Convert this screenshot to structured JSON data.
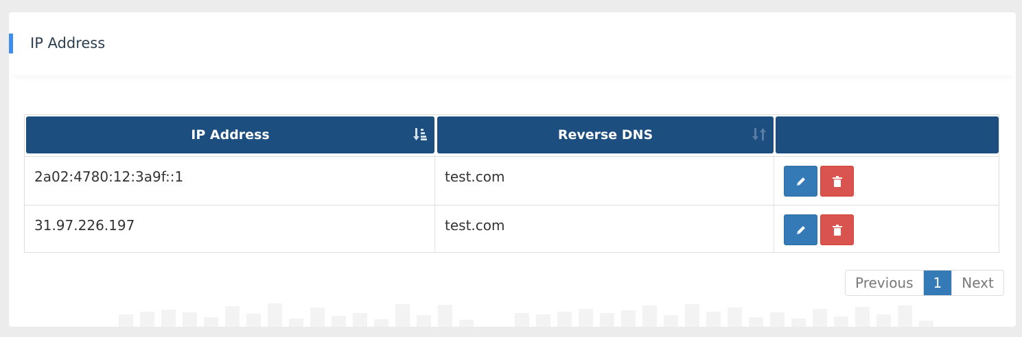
{
  "panel": {
    "title": "IP Address"
  },
  "table": {
    "columns": [
      {
        "label": "IP Address",
        "sort": "sorted-asc"
      },
      {
        "label": "Reverse DNS",
        "sort": "sortable"
      },
      {
        "label": ""
      }
    ],
    "rows": [
      {
        "ip": "2a02:4780:12:3a9f::1",
        "rdns": "test.com"
      },
      {
        "ip": "31.97.226.197",
        "rdns": "test.com"
      }
    ],
    "actions": {
      "edit_icon": "pencil-icon",
      "delete_icon": "trash-icon"
    }
  },
  "pagination": {
    "previous": "Previous",
    "pages": [
      "1"
    ],
    "current": "1",
    "next": "Next"
  },
  "colors": {
    "header_bg": "#1c4e80",
    "accent": "#3d8ef0",
    "edit": "#337ab7",
    "delete": "#d9534f"
  }
}
